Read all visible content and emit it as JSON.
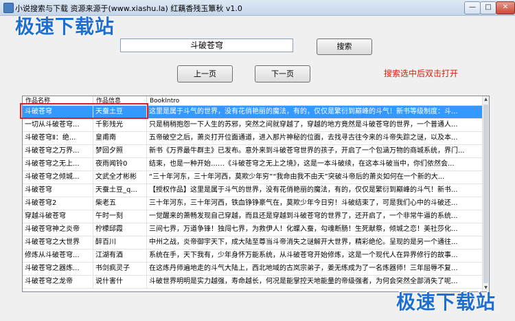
{
  "window": {
    "title": "小说搜索与下载  资源来源于(www.xiashu.la)  红藕香残玉簟秋  v1.0",
    "controls": {
      "minimize": "—",
      "maximize": "□",
      "close": "✕"
    }
  },
  "watermark": {
    "text": "极速下载站"
  },
  "search": {
    "value": "斗破苍穹",
    "button_label": "搜索"
  },
  "paging": {
    "prev_label": "上一页",
    "next_label": "下一页"
  },
  "hint": "搜索选中后双击打开",
  "table": {
    "columns": [
      "作品名称",
      "作品信息",
      "BookIntro"
    ],
    "selected_index": 0,
    "rows": [
      [
        "斗破苍穹",
        "天蚕土豆",
        "这里是属于斗气的世界，没有花俏艳丽的魔法，有的，仅仅是繁衍到巅峰的斗气！新书等级制度：斗..."
      ],
      [
        "一切从斗破苍穹...",
        "千影残光",
        "只是稍稍抱怨一下人生的苏邪，突然之间就穿越了，穿越的地方竟然是斗破苍穹的世界，一个普通人..."
      ],
      [
        "斗破苍穹Ⅱ：绝...",
        "皇甫南",
        "五帝破空之后，萧炎打开位面通道，进入那片神秘的位面，去找寻古往今来的斗帝失踪之谜，以及本..."
      ],
      [
        "斗破苍穹之万界...",
        "梦回夕照",
        "新书《万界最牛群主》已发布。意外来到斗破苍穹世界的孩子，开启了一个包涵万物的商城系统，界门..."
      ],
      [
        "斗破苍穹之无上...",
        "夜雨闻铃0",
        "结束，也是一种开始……《斗破苍穹之无上之境》，这是一本斗破续，在这本斗破当中，你们依然会..."
      ],
      [
        "斗破苍穹之倾城...",
        "文武全才彬彬",
        "“三十年河东，三十年河西，莫欺少年穷”“我命由我不由天”突破斗帝后的萧炎如何在一个新的大..."
      ],
      [
        "斗破苍穹",
        "天蚕土豆_q...",
        "【授权作品】这里是属于斗气的世界，没有花俏艳丽的魔法，有的，仅仅是繁衍到巅峰的斗气！新书..."
      ],
      [
        "斗破苍穹2",
        "柴老五",
        "三十年河东，三十年河西，铁血铮铮豪气在，莫欺少年今日穷！斗破结束了，可是我们心中的斗破还..."
      ],
      [
        "穿越斗破苍穹",
        "午时一刻",
        "一觉醒来的萧畅发现自己穿越，而且还是穿越到斗破苍穹的世界了，还开启了，一个非常牛逼的系统..."
      ],
      [
        "斗破苍穹神之炎帝",
        "柠檬邱霞",
        "三间七界，万道争锋！独闯七界，为救伊人！化蝶入蚕，勾魂断肠！生死献祭，倾城之恋！美社莎化..."
      ],
      [
        "斗破苍穹之大世界",
        "醉百川",
        "中州之战，炎帝御宇天下，成大陆至尊当斗帝消失之谜解开大世界，精彩绝伦。呈现的是另一个通往..."
      ],
      [
        "修炼从斗破苍穹...",
        "江湖有酒",
        "系统在手，天下我有，少年身怀万能系统，从斗破苍穹开始修炼，这是一个现代人在异界修行的故事..."
      ],
      [
        "斗破苍穹之器炼...",
        "书剑疯灵子",
        "在这炼丹师遍地走的斗气大陆上，西北地域的古岚宗弟子，姜无练成为了一名炼器师！三年屈辱不复..."
      ],
      [
        "斗破苍穹之龙帝",
        "说什害什",
        "斗破世界明明是实力越强，寿命越长，何况是能掌控天地能量的帝级强者，为何会突然全部消失了呢..."
      ]
    ]
  },
  "colors": {
    "selection": "#3399ff",
    "hint": "#d81e06",
    "watermark": "#1e6fcf",
    "highlight_box": "#e02020"
  }
}
